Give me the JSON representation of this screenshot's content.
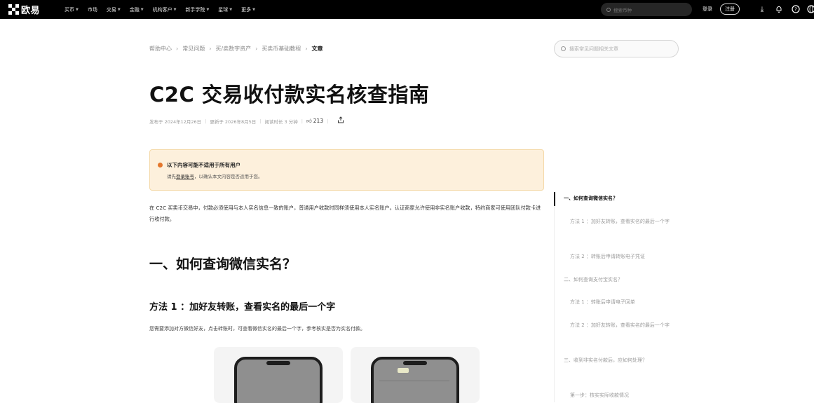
{
  "topbar": {
    "logo_text": "欧易",
    "nav": [
      {
        "label": "买币",
        "caret": true
      },
      {
        "label": "市场",
        "caret": false
      },
      {
        "label": "交易",
        "caret": true
      },
      {
        "label": "金融",
        "caret": true
      },
      {
        "label": "机构客户",
        "caret": true
      },
      {
        "label": "新手学院",
        "caret": true
      },
      {
        "label": "星球",
        "caret": true
      },
      {
        "label": "更多",
        "caret": true
      }
    ],
    "search_placeholder": "搜索币种",
    "login": "登录",
    "signup": "注册",
    "icons": [
      "download-icon",
      "bell-icon",
      "help-icon",
      "globe-icon"
    ]
  },
  "breadcrumb": {
    "items": [
      "帮助中心",
      "常见问题",
      "买/卖数字资产",
      "买卖币基础教程"
    ],
    "current": "文章"
  },
  "help_search_placeholder": "搜索常见问题相关文章",
  "article": {
    "title": "C2C 交易收付款实名核查指南",
    "meta": {
      "published": "发布于 2024年12月26日",
      "updated": "更新于 2026年8月5日",
      "read_time": "阅读时长 3 分钟",
      "likes": "213"
    },
    "notice": {
      "heading": "以下内容可能不适用于所有用户",
      "body_prefix": "请先",
      "body_link": "登录账号",
      "body_suffix": "，以确认本文内容是否适用于您。"
    },
    "intro": "在 C2C 买卖币交易中，付款必须使用与本人实名信息一致的账户，普通用户收款时同样须使用本人实名账户。认证商家允许使用非实名账户收款，特约商家可使用团队付款卡进行收付款。",
    "section1": "一、如何查询微信实名？",
    "method1": "方法 1 ：加好友转账，查看实名的最后一个字",
    "method1_body": "您需要添加对方微信好友，点击转账时，可查看微信实名的最后一个字，参考核实是否为实名付款。"
  },
  "toc": [
    {
      "label": "一、如何查询微信实名？",
      "active": true
    },
    {
      "label": "方法 1 ：加好友转账，查看实名的最后一个字",
      "active": false
    },
    {
      "label": "方法 2 ：转账后申请转账电子凭证",
      "active": false
    },
    {
      "label": "二、如何查询支付宝实名？",
      "active": false
    },
    {
      "label": "方法 1 ：转账后申请电子回单",
      "active": false
    },
    {
      "label": "方法 2 ：加好友转账，查看实名的最后一个字",
      "active": false
    },
    {
      "label": "三、收到非实名付款后，应如何处理？",
      "active": false
    },
    {
      "label": "第一步：核实实际收款情况",
      "active": false
    }
  ]
}
